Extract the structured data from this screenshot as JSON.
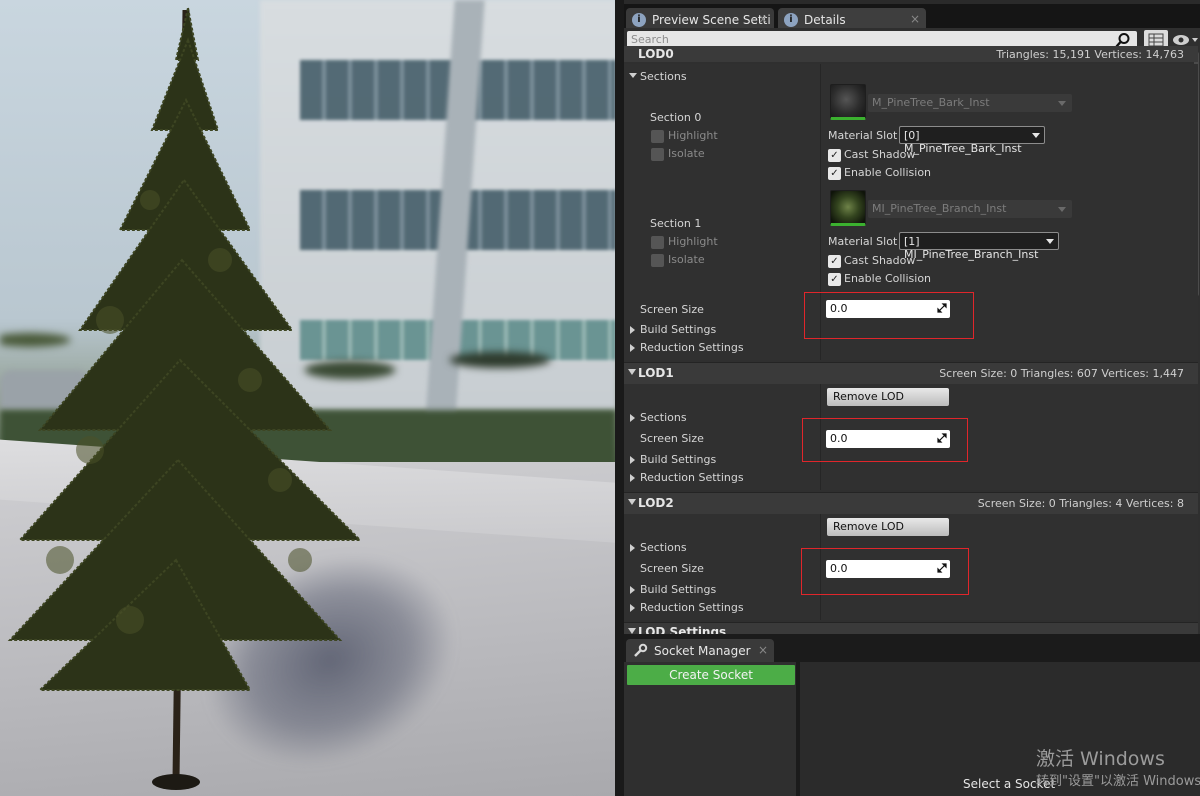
{
  "tabs": [
    {
      "label": "Preview Scene Setti",
      "icon": "info-icon"
    },
    {
      "label": "Details",
      "icon": "info-icon"
    }
  ],
  "search": {
    "placeholder": "Search"
  },
  "lod0": {
    "title": "LOD0",
    "stats": "Triangles: 15,191    Vertices: 14,763",
    "sections_label": "Sections",
    "section0": {
      "label": "Section 0",
      "highlight": "Highlight",
      "isolate": "Isolate",
      "material": "M_PineTree_Bark_Inst",
      "material_slot_label": "Material Slot",
      "material_slot": "[0] M_PineTree_Bark_Inst",
      "cast_shadow": "Cast Shadow",
      "enable_collision": "Enable Collision"
    },
    "section1": {
      "label": "Section 1",
      "highlight": "Highlight",
      "isolate": "Isolate",
      "material": "MI_PineTree_Branch_Inst",
      "material_slot_label": "Material Slot",
      "material_slot": "[1] MI_PineTree_Branch_Inst",
      "cast_shadow": "Cast Shadow",
      "enable_collision": "Enable Collision"
    },
    "screen_size_label": "Screen Size",
    "screen_size": "0.0",
    "build_settings": "Build Settings",
    "reduction_settings": "Reduction Settings"
  },
  "lod1": {
    "title": "LOD1",
    "stats": "Screen Size: 0    Triangles: 607    Vertices: 1,447",
    "remove": "Remove LOD",
    "sections_label": "Sections",
    "screen_size_label": "Screen Size",
    "screen_size": "0.0",
    "build_settings": "Build Settings",
    "reduction_settings": "Reduction Settings"
  },
  "lod2": {
    "title": "LOD2",
    "stats": "Screen Size: 0    Triangles: 4    Vertices: 8",
    "remove": "Remove LOD",
    "sections_label": "Sections",
    "screen_size_label": "Screen Size",
    "screen_size": "0.0",
    "build_settings": "Build Settings",
    "reduction_settings": "Reduction Settings"
  },
  "lod_settings": "LOD Settings",
  "socket_manager": {
    "tab": "Socket Manager",
    "create": "Create Socket",
    "select": "Select a Socket"
  },
  "watermark": {
    "line1": "激活 Windows",
    "line2": "转到\"设置\"以激活 Windows。"
  },
  "colors": {
    "accent_green": "#4cad47",
    "highlight_red": "#e0262b"
  }
}
